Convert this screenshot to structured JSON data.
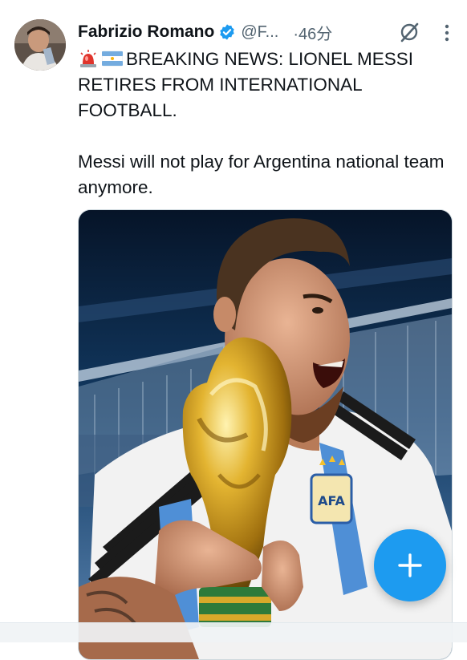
{
  "author": {
    "name": "Fabrizio Romano",
    "handle": "@F...",
    "time": "·46分"
  },
  "tweet": {
    "line1": "BREAKING NEWS: LIONEL MESSI RETIRES FROM INTERNATIONAL FOOTBALL.",
    "line2": "Messi will not play for Argentina national team anymore."
  },
  "colors": {
    "accent": "#1d9bf0",
    "text": "#0f1419",
    "muted": "#536471"
  },
  "icons": {
    "verified": "verified-badge-icon",
    "grok": "grok-icon",
    "more": "more-options-icon",
    "siren": "siren-emoji",
    "flag": "argentina-flag-emoji",
    "compose": "plus-icon"
  }
}
